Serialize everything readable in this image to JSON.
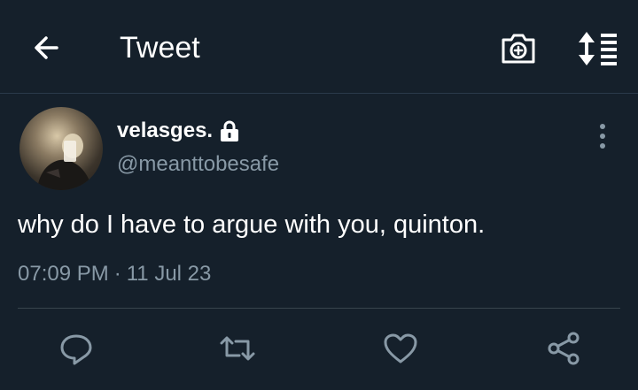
{
  "header": {
    "title": "Tweet",
    "back_icon": "arrow-left-icon",
    "camera_icon": "camera-plus-icon",
    "sort_icon": "sort-list-icon"
  },
  "tweet": {
    "display_name": "velasges.",
    "handle": "@meanttobesafe",
    "protected": true,
    "text": "why do I have to argue with you, quinton.",
    "time": "07:09 PM",
    "separator": "·",
    "date": "11 Jul 23"
  },
  "actions": [
    {
      "name": "reply",
      "icon": "reply-bubble-icon"
    },
    {
      "name": "retweet",
      "icon": "retweet-icon"
    },
    {
      "name": "like",
      "icon": "heart-icon"
    },
    {
      "name": "share",
      "icon": "share-icon"
    }
  ],
  "colors": {
    "background": "#15202b",
    "text_primary": "#ffffff",
    "text_secondary": "#8899a6",
    "divider": "#38444d",
    "icon": "#8899a6"
  }
}
